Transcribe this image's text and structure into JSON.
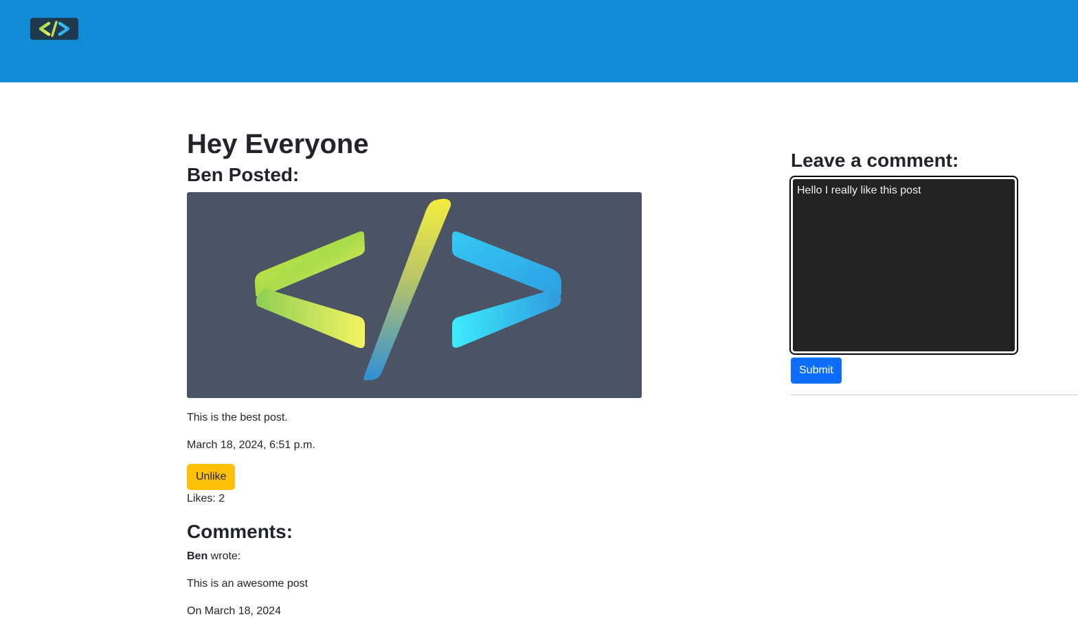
{
  "navbar": {
    "logo_icon": "code-brackets-icon",
    "background_color": "#128bd4"
  },
  "post": {
    "title": "Hey Everyone",
    "author_line": "Ben Posted:",
    "image_icon": "code-brackets-icon",
    "body": "This is the best post.",
    "date": "March 18, 2024, 6:51 p.m.",
    "like_button_label": "Unlike",
    "likes_text": "Likes: 2"
  },
  "comments": {
    "heading": "Comments:",
    "items": [
      {
        "author": "Ben",
        "wrote_label": " wrote:",
        "text": "This is an awesome post",
        "date": "On March 18, 2024"
      }
    ]
  },
  "comment_form": {
    "heading": "Leave a comment:",
    "input_value": "Hello I really like this post",
    "submit_label": "Submit"
  },
  "colors": {
    "accent_blue": "#0d6efd",
    "like_yellow": "#ffc107",
    "image_background": "#4a5465"
  }
}
